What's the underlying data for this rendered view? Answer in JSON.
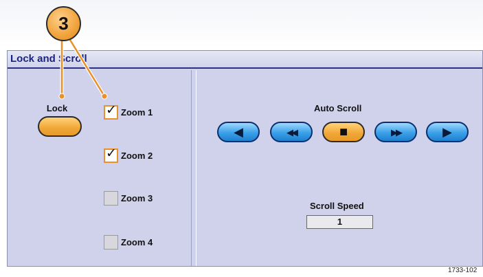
{
  "callout": {
    "number": "3"
  },
  "panel": {
    "title": "Lock and Scroll",
    "lock": {
      "label": "Lock",
      "color": "#f0a636"
    },
    "zooms": [
      {
        "label": "Zoom 1",
        "checked": true
      },
      {
        "label": "Zoom 2",
        "checked": true
      },
      {
        "label": "Zoom 3",
        "checked": false
      },
      {
        "label": "Zoom 4",
        "checked": false
      }
    ],
    "auto_scroll": {
      "label": "Auto Scroll",
      "buttons": [
        {
          "name": "scroll-left",
          "icon": "left-triangle-icon",
          "glyph": "◀"
        },
        {
          "name": "fast-scroll-left",
          "icon": "double-left-arrow-icon",
          "glyph": "◀◀"
        },
        {
          "name": "stop-scroll",
          "icon": "stop-square-icon",
          "glyph": "■",
          "active": true
        },
        {
          "name": "fast-scroll-right",
          "icon": "double-right-arrow-icon",
          "glyph": "▶▶"
        },
        {
          "name": "scroll-right",
          "icon": "right-triangle-icon",
          "glyph": "▶"
        }
      ]
    },
    "scroll_speed": {
      "label": "Scroll Speed",
      "value": "1"
    }
  },
  "figure_id": "1733-102",
  "colors": {
    "panel_bg": "#cfd2ea",
    "title_text": "#1a237e",
    "button_blue": "#3aa0e8",
    "active_orange": "#f0a636"
  }
}
